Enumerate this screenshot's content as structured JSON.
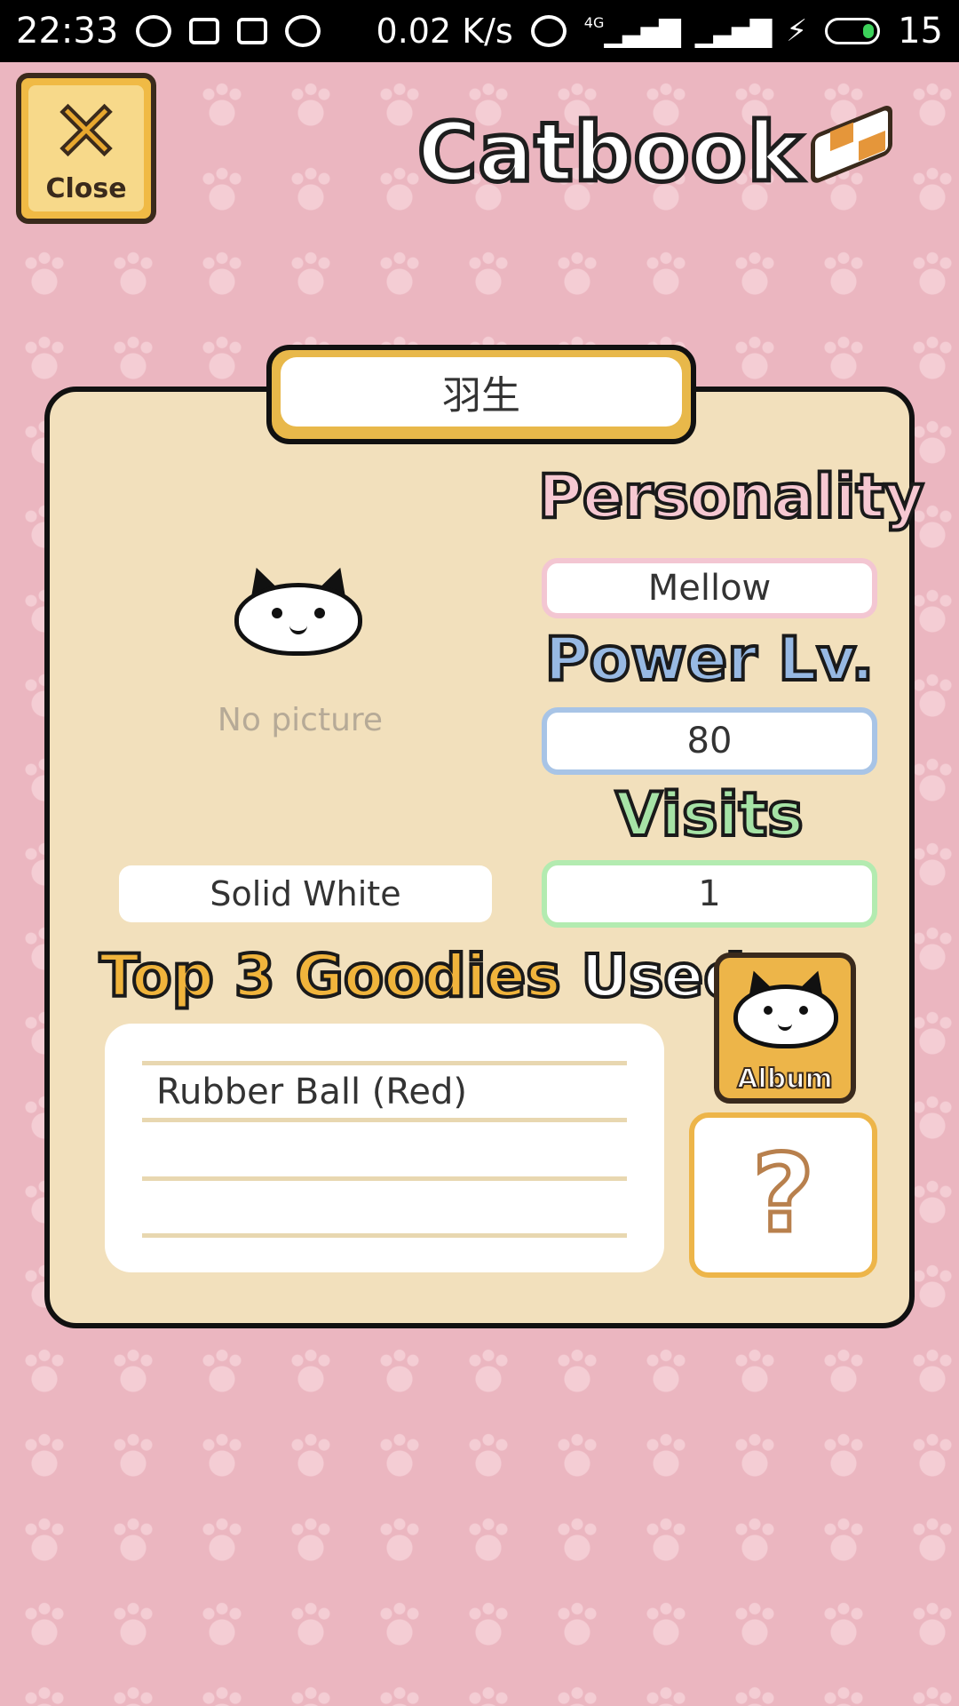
{
  "status_bar": {
    "time": "22:33",
    "net_speed": "0.02 K/s",
    "network_type": "4G",
    "battery": "15",
    "icons": [
      "browser-icon",
      "image-icon",
      "sim-icon",
      "chat-icon",
      "alarm-icon",
      "signal-icon",
      "charging-icon",
      "battery-icon"
    ]
  },
  "header": {
    "close_label": "Close",
    "title": "Catbook"
  },
  "cat": {
    "name": "羽生",
    "picture_placeholder": "No picture",
    "coat": "Solid White"
  },
  "stats": {
    "personality_label": "Personality",
    "personality": "Mellow",
    "power_label": "Power Lv.",
    "power": "80",
    "visits_label": "Visits",
    "visits": "1"
  },
  "goodies": {
    "heading_part1": "Top 3 Goodies",
    "heading_part2": "Used",
    "items": [
      "Rubber Ball (Red)",
      "",
      ""
    ]
  },
  "buttons": {
    "album_label": "Album",
    "help_symbol": "?"
  },
  "colors": {
    "background": "#ebb6c0",
    "card": "#f2e0bc",
    "accent": "#edb549",
    "personality": "#f6c8d2",
    "power": "#97b9e3",
    "visits": "#a6e3a6"
  }
}
